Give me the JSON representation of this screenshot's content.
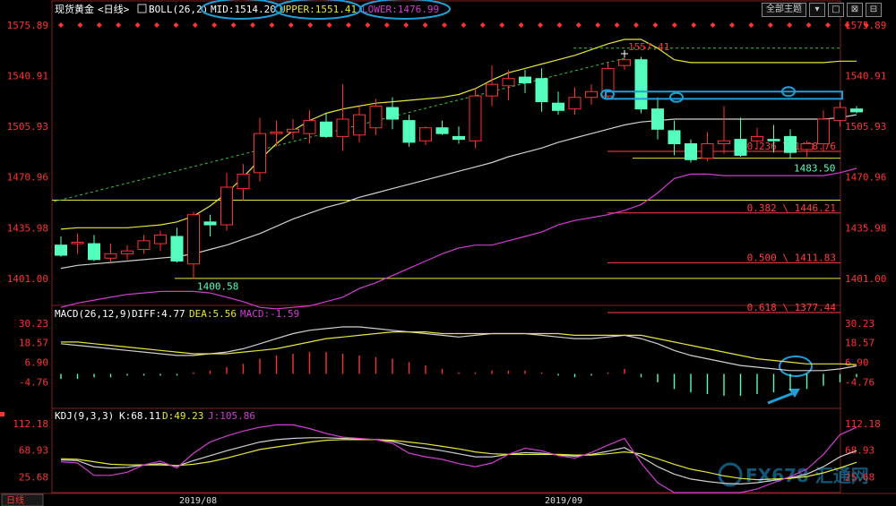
{
  "header": {
    "instrument": "现货黄金",
    "period": "<日线>",
    "boll_label": "BOLL(26,2)",
    "mid": "MID:1514.20",
    "upper": "UPPER:1551.41",
    "lower": "LOWER:1476.99"
  },
  "toolbar": {
    "topic_select": "全部主题",
    "btn1": "▾",
    "btn2": "□",
    "btn3": "⊠",
    "btn4": "⊟"
  },
  "macd_header": {
    "label": "MACD(26,12,9)",
    "diff": "DIFF:4.77",
    "dea": "DEA:5.56",
    "macd": "MACD:-1.59"
  },
  "kdj_header": {
    "label": "KDJ(9,3,3)",
    "k": "K:68.11",
    "d": "D:49.23",
    "j": "J:105.86"
  },
  "footer": {
    "period_tab": "日线",
    "month1": "2019/08",
    "month2": "2019/09"
  },
  "watermark": "FX678 汇通网",
  "colors": {
    "up": "#ff3232",
    "down": "#54ffbe",
    "mid": "#d0d0d0",
    "upper": "#e6e639",
    "lower": "#d23cd2",
    "fib": "#ff4040",
    "hline": "#e6e639",
    "bg": "#000000"
  },
  "chart_data": [
    {
      "type": "candlestick",
      "title": "现货黄金 <日线> BOLL(26,2)",
      "ylim": [
        1383,
        1592
      ],
      "yticks": [
        1575.89,
        1540.91,
        1505.93,
        1470.96,
        1435.98,
        1401.0
      ],
      "ytick_labels": [
        "1575.89",
        "1540.91",
        "1505.93",
        "1470.96",
        "1435.98",
        "1401.00"
      ],
      "candles": [
        {
          "o": 1424,
          "h": 1430,
          "l": 1416,
          "c": 1417
        },
        {
          "o": 1425,
          "h": 1432,
          "l": 1418,
          "c": 1426
        },
        {
          "o": 1425,
          "h": 1431,
          "l": 1413,
          "c": 1414
        },
        {
          "o": 1415,
          "h": 1425,
          "l": 1412,
          "c": 1418
        },
        {
          "o": 1418,
          "h": 1424,
          "l": 1414,
          "c": 1420
        },
        {
          "o": 1421,
          "h": 1431,
          "l": 1418,
          "c": 1427
        },
        {
          "o": 1425,
          "h": 1434,
          "l": 1420,
          "c": 1431
        },
        {
          "o": 1430,
          "h": 1436,
          "l": 1412,
          "c": 1413
        },
        {
          "o": 1411,
          "h": 1447,
          "l": 1400.58,
          "c": 1445
        },
        {
          "o": 1440,
          "h": 1445,
          "l": 1430,
          "c": 1438
        },
        {
          "o": 1438,
          "h": 1474,
          "l": 1434,
          "c": 1464
        },
        {
          "o": 1463,
          "h": 1480,
          "l": 1455,
          "c": 1473
        },
        {
          "o": 1474,
          "h": 1512,
          "l": 1468,
          "c": 1501
        },
        {
          "o": 1501,
          "h": 1510,
          "l": 1492,
          "c": 1502
        },
        {
          "o": 1502,
          "h": 1511,
          "l": 1497,
          "c": 1504
        },
        {
          "o": 1501,
          "h": 1517,
          "l": 1494,
          "c": 1510
        },
        {
          "o": 1509,
          "h": 1515,
          "l": 1498,
          "c": 1499
        },
        {
          "o": 1499,
          "h": 1535,
          "l": 1489,
          "c": 1511
        },
        {
          "o": 1500,
          "h": 1520,
          "l": 1495,
          "c": 1514
        },
        {
          "o": 1505,
          "h": 1525,
          "l": 1500,
          "c": 1520
        },
        {
          "o": 1519,
          "h": 1526,
          "l": 1504,
          "c": 1511
        },
        {
          "o": 1510,
          "h": 1514,
          "l": 1492,
          "c": 1495
        },
        {
          "o": 1496,
          "h": 1506,
          "l": 1493,
          "c": 1505
        },
        {
          "o": 1505,
          "h": 1510,
          "l": 1500,
          "c": 1501
        },
        {
          "o": 1499,
          "h": 1506,
          "l": 1494,
          "c": 1497
        },
        {
          "o": 1496,
          "h": 1532,
          "l": 1491,
          "c": 1527
        },
        {
          "o": 1527,
          "h": 1548,
          "l": 1520,
          "c": 1535
        },
        {
          "o": 1534,
          "h": 1545,
          "l": 1524,
          "c": 1539
        },
        {
          "o": 1540,
          "h": 1545,
          "l": 1529,
          "c": 1536
        },
        {
          "o": 1539,
          "h": 1546,
          "l": 1516,
          "c": 1523
        },
        {
          "o": 1522,
          "h": 1530,
          "l": 1514,
          "c": 1517
        },
        {
          "o": 1518,
          "h": 1533,
          "l": 1514,
          "c": 1526
        },
        {
          "o": 1526,
          "h": 1535,
          "l": 1521,
          "c": 1530
        },
        {
          "o": 1527,
          "h": 1550,
          "l": 1525,
          "c": 1546
        },
        {
          "o": 1548,
          "h": 1557.41,
          "l": 1545,
          "c": 1552
        },
        {
          "o": 1552,
          "h": 1554,
          "l": 1515,
          "c": 1518
        },
        {
          "o": 1518,
          "h": 1526,
          "l": 1497,
          "c": 1504
        },
        {
          "o": 1503,
          "h": 1510,
          "l": 1486,
          "c": 1494
        },
        {
          "o": 1494,
          "h": 1497,
          "l": 1481,
          "c": 1483
        },
        {
          "o": 1484,
          "h": 1502,
          "l": 1482,
          "c": 1494
        },
        {
          "o": 1494,
          "h": 1520,
          "l": 1487,
          "c": 1496
        },
        {
          "o": 1497,
          "h": 1512,
          "l": 1485,
          "c": 1486
        },
        {
          "o": 1496,
          "h": 1505,
          "l": 1490,
          "c": 1499
        },
        {
          "o": 1497,
          "h": 1507,
          "l": 1488,
          "c": 1496
        },
        {
          "o": 1499,
          "h": 1504,
          "l": 1483.5,
          "c": 1488
        },
        {
          "o": 1490,
          "h": 1496,
          "l": 1485,
          "c": 1494
        },
        {
          "o": 1494,
          "h": 1517,
          "l": 1489,
          "c": 1511
        },
        {
          "o": 1510,
          "h": 1523,
          "l": 1506,
          "c": 1519
        },
        {
          "o": 1518,
          "h": 1520,
          "l": 1515,
          "c": 1516
        }
      ],
      "mid_band": [
        1408,
        1410,
        1411,
        1412,
        1413,
        1414,
        1415,
        1416,
        1418,
        1421,
        1424,
        1428,
        1432,
        1437,
        1442,
        1446,
        1450,
        1453,
        1457,
        1460,
        1463,
        1466,
        1469,
        1472,
        1475,
        1478,
        1481,
        1485,
        1488,
        1491,
        1495,
        1498,
        1501,
        1504,
        1507,
        1509,
        1510,
        1511,
        1511,
        1511,
        1511,
        1511,
        1511,
        1511,
        1511,
        1511,
        1511,
        1512,
        1514
      ],
      "upper_band": [
        1435,
        1436,
        1436,
        1436,
        1436,
        1437,
        1438,
        1440,
        1444,
        1451,
        1460,
        1471,
        1483,
        1494,
        1503,
        1510,
        1515,
        1518,
        1520,
        1522,
        1523,
        1524,
        1525,
        1526,
        1528,
        1532,
        1538,
        1543,
        1546,
        1549,
        1552,
        1555,
        1559,
        1563,
        1566,
        1566,
        1560,
        1552,
        1550,
        1550,
        1550,
        1550,
        1550,
        1550,
        1550,
        1550,
        1550,
        1551,
        1551
      ],
      "lower_band": [
        1381,
        1384,
        1386,
        1388,
        1390,
        1391,
        1392,
        1392,
        1392,
        1391,
        1388,
        1385,
        1381,
        1380,
        1381,
        1382,
        1385,
        1388,
        1394,
        1398,
        1403,
        1408,
        1413,
        1418,
        1422,
        1424,
        1424,
        1427,
        1430,
        1433,
        1438,
        1441,
        1443,
        1445,
        1448,
        1452,
        1460,
        1470,
        1473,
        1473,
        1472,
        1472,
        1472,
        1472,
        1472,
        1472,
        1472,
        1474,
        1477
      ],
      "annotations": [
        {
          "text": "1557.41",
          "value": 1557.41,
          "index": 34
        },
        {
          "text": "1400.58",
          "value": 1400.58,
          "index": 8
        },
        {
          "text": "1483.50",
          "value": 1483.5,
          "index": 44
        }
      ],
      "fib_levels": [
        {
          "text": "0.236 \\ 1488.76",
          "value": 1488.76
        },
        {
          "text": "0.382 \\ 1446.21",
          "value": 1446.21
        },
        {
          "text": "0.500 \\ 1411.83",
          "value": 1411.83
        },
        {
          "text": "0.618 \\ 1377.44",
          "value": 1377.44
        }
      ],
      "horizontal_lines": [
        1455,
        1401,
        1484
      ],
      "trend_line": {
        "from": {
          "index": 0,
          "value": 1454
        },
        "to": {
          "index": 34,
          "value": 1553
        }
      },
      "resistance_line": 1560
    },
    {
      "type": "bar",
      "title": "MACD(26,12,9)",
      "ylim": [
        -20,
        36
      ],
      "yticks": [
        30.23,
        18.57,
        6.9,
        -4.76
      ],
      "ytick_labels": [
        "30.23",
        "18.57",
        "6.90",
        "-4.76"
      ],
      "histogram": [
        -3,
        -3,
        -2,
        -2,
        -1,
        -1,
        -1,
        -1,
        1,
        2,
        4,
        6,
        9,
        11,
        12,
        13,
        13,
        12,
        11,
        10,
        9,
        7,
        5,
        3,
        1,
        1,
        2,
        2,
        2,
        1,
        -1,
        -2,
        -1,
        1,
        3,
        -2,
        -5,
        -9,
        -11,
        -12,
        -13,
        -13,
        -12,
        -11,
        -10,
        -9,
        -7,
        -5,
        -2
      ],
      "diff": [
        18,
        17,
        16,
        15,
        14,
        13,
        12,
        11,
        11,
        12,
        13,
        15,
        18,
        21,
        24,
        26,
        27,
        28,
        28,
        27,
        26,
        25,
        24,
        23,
        22,
        23,
        24,
        24,
        24,
        23,
        22,
        21,
        21,
        22,
        23,
        21,
        18,
        14,
        11,
        9,
        7,
        5,
        4,
        3,
        2,
        2,
        2,
        3,
        4.77
      ],
      "dea": [
        19,
        19,
        18,
        17,
        16,
        15,
        14,
        13,
        12,
        12,
        12,
        13,
        14,
        15,
        17,
        19,
        21,
        22,
        23,
        24,
        25,
        25,
        25,
        24,
        24,
        24,
        24,
        24,
        24,
        24,
        24,
        23,
        23,
        23,
        23,
        23,
        21,
        19,
        17,
        15,
        13,
        11,
        9,
        8,
        7,
        6,
        6,
        6,
        5.56
      ]
    },
    {
      "type": "line",
      "title": "KDJ(9,3,3)",
      "ylim": [
        0,
        128
      ],
      "yticks": [
        112.18,
        68.93,
        25.68
      ],
      "ytick_labels": [
        "112.18",
        "68.93",
        "25.68"
      ],
      "series": [
        {
          "name": "K",
          "values": [
            53,
            52,
            42,
            40,
            41,
            45,
            47,
            43,
            52,
            60,
            68,
            75,
            82,
            86,
            88,
            89,
            89,
            88,
            87,
            86,
            83,
            76,
            72,
            68,
            63,
            58,
            58,
            62,
            65,
            64,
            61,
            59,
            62,
            67,
            73,
            58,
            42,
            30,
            22,
            18,
            15,
            14,
            16,
            20,
            24,
            30,
            42,
            58,
            68.11
          ]
        },
        {
          "name": "D",
          "values": [
            55,
            54,
            50,
            46,
            45,
            45,
            45,
            44,
            46,
            50,
            56,
            63,
            70,
            74,
            78,
            82,
            85,
            86,
            86,
            86,
            85,
            82,
            79,
            75,
            71,
            66,
            63,
            62,
            62,
            62,
            62,
            61,
            61,
            63,
            66,
            63,
            55,
            46,
            38,
            33,
            27,
            23,
            21,
            22,
            23,
            26,
            32,
            40,
            49.23
          ]
        },
        {
          "name": "J",
          "values": [
            50,
            48,
            28,
            28,
            33,
            45,
            51,
            40,
            64,
            82,
            92,
            100,
            106,
            110,
            110,
            104,
            96,
            90,
            88,
            86,
            80,
            64,
            58,
            54,
            47,
            42,
            48,
            62,
            72,
            68,
            60,
            56,
            65,
            77,
            88,
            48,
            16,
            -2,
            -10,
            -12,
            -8,
            -5,
            6,
            16,
            26,
            38,
            62,
            94,
            105.86
          ]
        }
      ]
    }
  ]
}
